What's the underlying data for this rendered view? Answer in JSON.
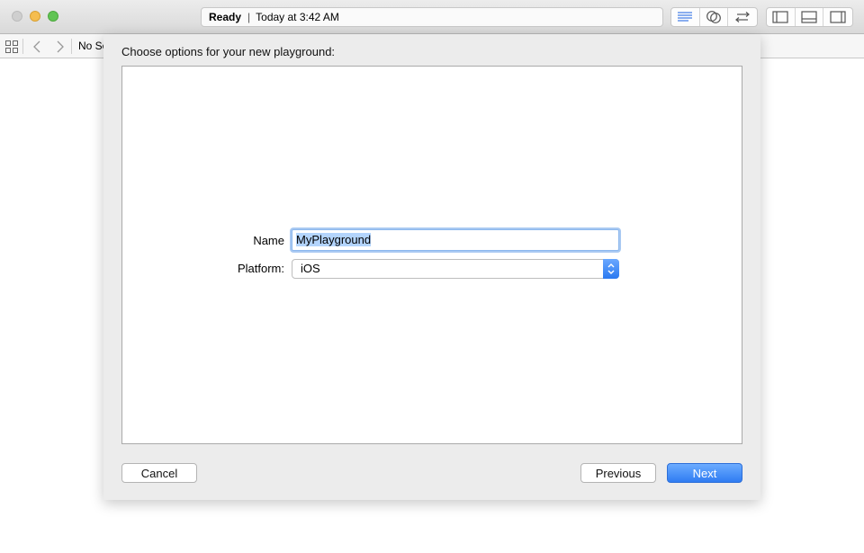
{
  "toolbar": {
    "status": "Ready",
    "separator": "|",
    "timestamp": "Today at 3:42 AM",
    "editor_buttons": [
      "standard-editor-icon",
      "assistant-editor-icon",
      "version-editor-icon"
    ],
    "view_buttons": [
      "navigator-toggle-icon",
      "debug-area-toggle-icon",
      "utilities-toggle-icon"
    ]
  },
  "jumpbar": {
    "text": "No Se"
  },
  "sheet": {
    "title": "Choose options for your new playground:",
    "name_label": "Name",
    "name_value": "MyPlayground",
    "platform_label": "Platform:",
    "platform_value": "iOS",
    "cancel_label": "Cancel",
    "previous_label": "Previous",
    "next_label": "Next"
  },
  "colors": {
    "accent": "#2f7cf2",
    "selection": "#b3d4fc",
    "close": "#cfcfcf",
    "minimize": "#f5bd4f",
    "zoom": "#61c454"
  }
}
